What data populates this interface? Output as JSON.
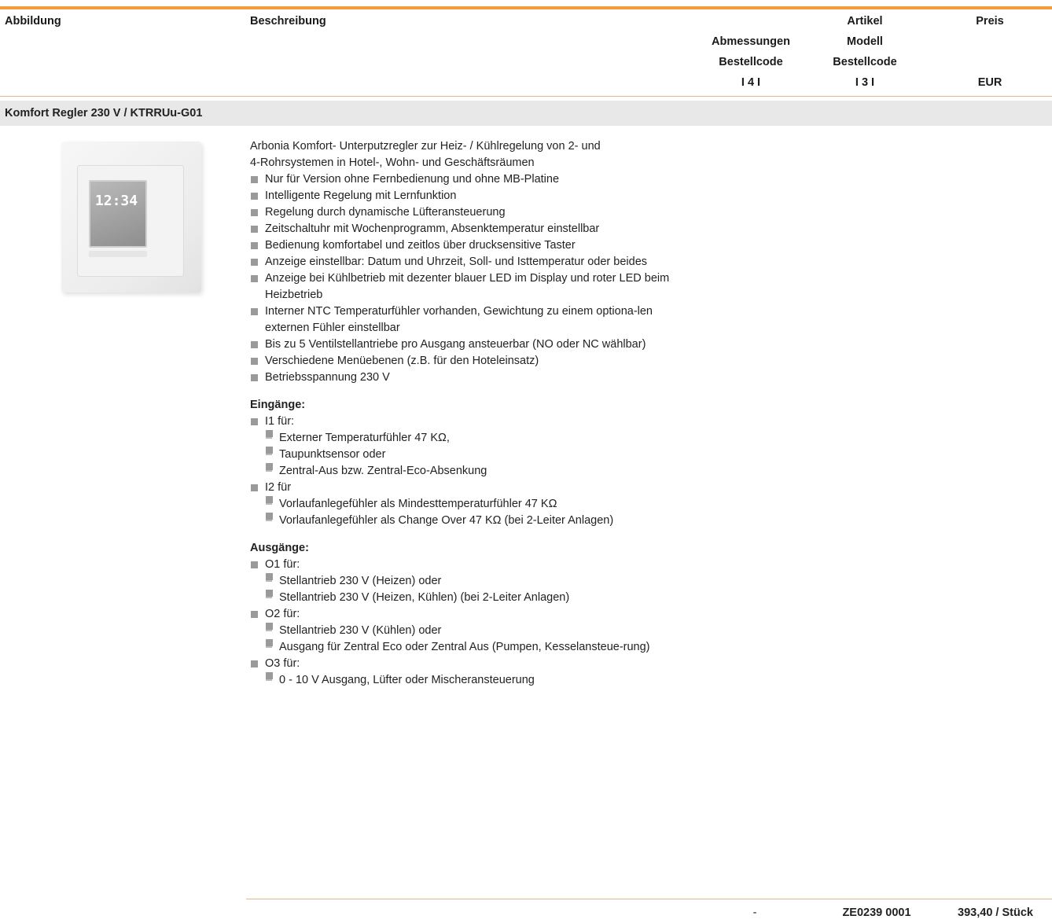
{
  "header": {
    "abbildung": "Abbildung",
    "beschreibung": "Beschreibung",
    "abmessungen": [
      "Abmessungen",
      "Bestellcode",
      "I 4 I"
    ],
    "artikel": [
      "Artikel",
      "Modell",
      "Bestellcode",
      "I 3 I"
    ],
    "preis": "Preis",
    "currency": "EUR"
  },
  "section_title": "Komfort Regler 230 V / KTRRUu-G01",
  "image": {
    "display_time": "12:34",
    "description": "product photo"
  },
  "description": {
    "intro": [
      "Arbonia Komfort- Unterputzregler zur Heiz- / Kühlregelung von 2- und",
      "4-Rohrsystemen in Hotel-, Wohn- und Geschäftsräumen"
    ],
    "features": [
      "Nur für Version ohne Fernbedienung und ohne MB-Platine",
      "Intelligente Regelung mit Lernfunktion",
      "Regelung durch dynamische Lüfteransteuerung",
      "Zeitschaltuhr mit Wochenprogramm, Absenktemperatur einstellbar",
      "Bedienung komfortabel und zeitlos über drucksensitive Taster",
      "Anzeige einstellbar: Datum und Uhrzeit, Soll- und Isttemperatur oder beides",
      "Anzeige bei Kühlbetrieb mit dezenter blauer LED im Display und roter LED beim Heizbetrieb",
      "Interner NTC Temperaturfühler vorhanden, Gewichtung zu einem optiona-len externen Fühler einstellbar",
      "Bis zu 5 Ventilstellantriebe pro Ausgang ansteuerbar (NO oder NC wählbar)",
      "Verschiedene Menüebenen  (z.B. für den Hoteleinsatz)",
      "Betriebsspannung 230 V"
    ],
    "inputs_title": "Eingänge:",
    "inputs": [
      {
        "label": "I1 für:",
        "items": [
          "Externer Temperaturfühler 47 KΩ,",
          "Taupunktsensor oder",
          "Zentral-Aus bzw. Zentral-Eco-Absenkung"
        ]
      },
      {
        "label": "I2 für",
        "items": [
          "Vorlaufanlegefühler als Mindesttemperaturfühler 47 KΩ",
          "Vorlaufanlegefühler als Change Over 47 KΩ (bei 2-Leiter Anlagen)"
        ]
      }
    ],
    "outputs_title": "Ausgänge:",
    "outputs": [
      {
        "label": "O1 für:",
        "items": [
          "Stellantrieb 230 V (Heizen) oder",
          "Stellantrieb 230 V (Heizen, Kühlen) (bei 2-Leiter Anlagen)"
        ]
      },
      {
        "label": "O2 für:",
        "items": [
          "Stellantrieb 230 V (Kühlen) oder",
          "Ausgang für Zentral Eco oder Zentral Aus (Pumpen, Kesselansteue-rung)"
        ]
      },
      {
        "label": "O3 für:",
        "items": [
          "0 - 10 V Ausgang, Lüfter oder Mischeransteuerung"
        ]
      }
    ]
  },
  "footer": {
    "abmessungen": "-",
    "bestellcode": "ZE0239 0001",
    "preis": "393,40 / Stück"
  }
}
